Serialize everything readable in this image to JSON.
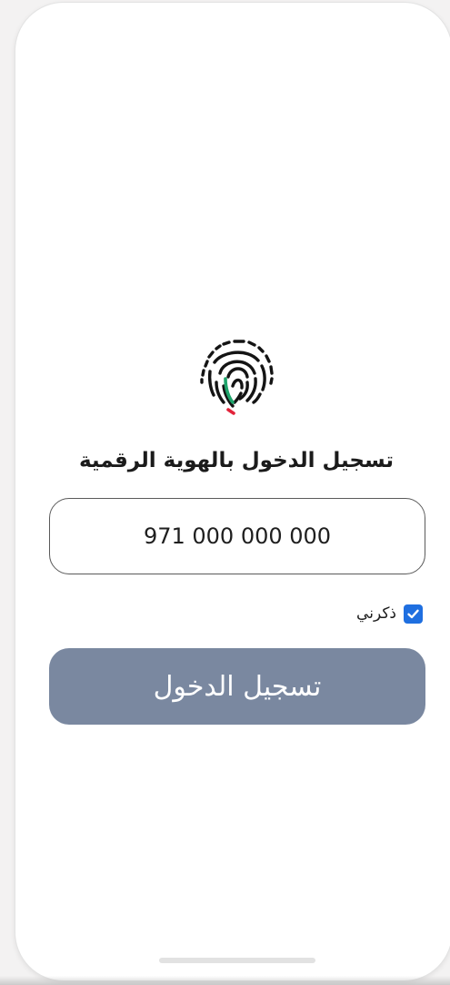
{
  "screen": {
    "title": "تسجيل الدخول بالهوية الرقمية"
  },
  "logo": {
    "icon": "fingerprint-icon",
    "colors": {
      "lines": "#141414",
      "accent_green": "#1ea46b",
      "accent_red": "#e2233a"
    }
  },
  "phone_field": {
    "value": "971 000 000 000"
  },
  "remember_me": {
    "label": "ذكرني",
    "checked": true,
    "check_icon": "checkmark-icon",
    "color": "#1f6fe0"
  },
  "login_button": {
    "label": "تسجيل الدخول",
    "color": "#7a88a0"
  }
}
